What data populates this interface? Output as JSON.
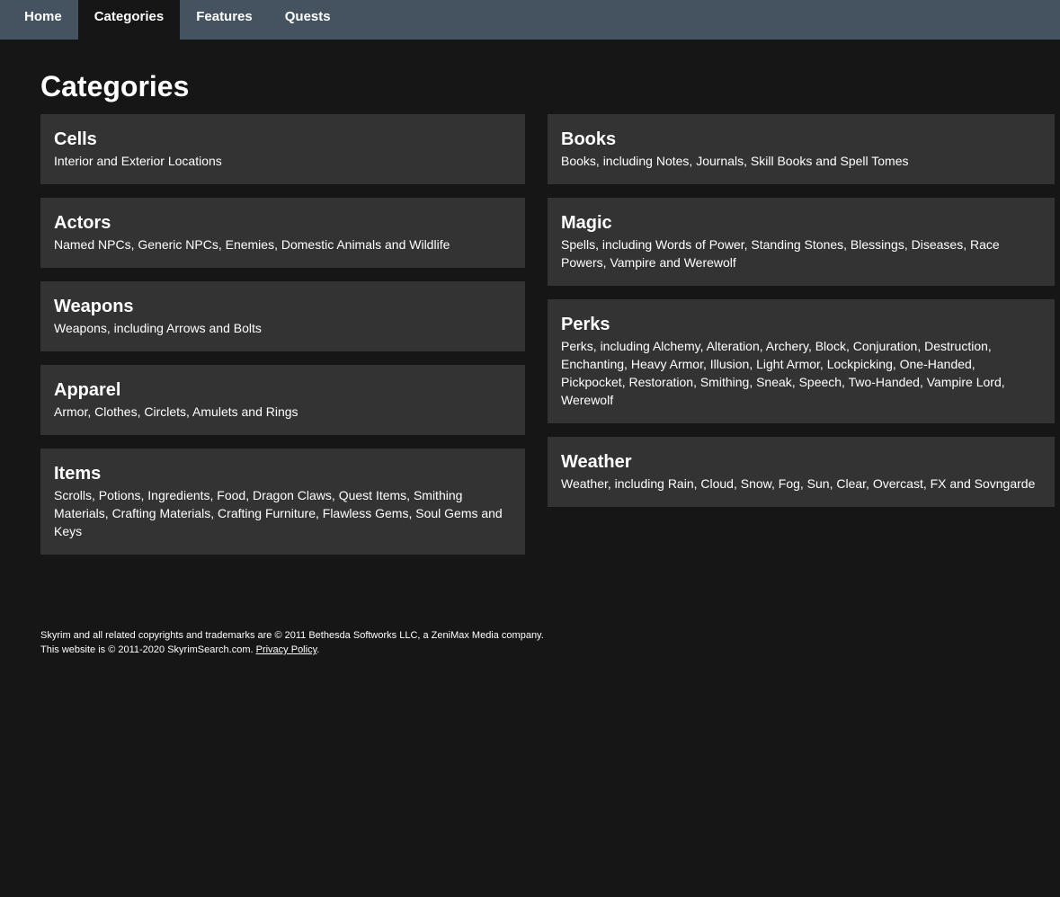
{
  "nav": {
    "items": [
      {
        "label": "Home"
      },
      {
        "label": "Categories"
      },
      {
        "label": "Features"
      },
      {
        "label": "Quests"
      }
    ],
    "active": "Categories"
  },
  "page": {
    "title": "Categories"
  },
  "categories_left": [
    {
      "title": "Cells",
      "desc": "Interior and Exterior Locations"
    },
    {
      "title": "Actors",
      "desc": "Named NPCs, Generic NPCs, Enemies, Domestic Animals and Wildlife"
    },
    {
      "title": "Weapons",
      "desc": "Weapons, including Arrows and Bolts"
    },
    {
      "title": "Apparel",
      "desc": "Armor, Clothes, Circlets, Amulets and Rings"
    },
    {
      "title": "Items",
      "desc": "Scrolls, Potions, Ingredients, Food, Dragon Claws, Quest Items, Smithing Materials, Crafting Materials, Crafting Furniture, Flawless Gems, Soul Gems and Keys"
    }
  ],
  "categories_right": [
    {
      "title": "Books",
      "desc": "Books, including Notes, Journals, Skill Books and Spell Tomes"
    },
    {
      "title": "Magic",
      "desc": "Spells, including Words of Power, Standing Stones, Blessings, Diseases, Race Powers, Vampire and Werewolf"
    },
    {
      "title": "Perks",
      "desc": "Perks, including Alchemy, Alteration, Archery, Block, Conjuration, Destruction, Enchanting, Heavy Armor, Illusion, Light Armor, Lockpicking, One-Handed, Pickpocket, Restoration, Smithing, Sneak, Speech, Two-Handed, Vampire Lord, Werewolf"
    },
    {
      "title": "Weather",
      "desc": "Weather, including Rain, Cloud, Snow, Fog, Sun, Clear, Overcast, FX and Sovngarde"
    }
  ],
  "footer": {
    "line1": "Skyrim and all related copyrights and trademarks are © 2011 Bethesda Softworks LLC, a ZeniMax Media company.",
    "line2_prefix": "This website is © 2011-2020 SkyrimSearch.com. ",
    "privacy_link": "Privacy Policy",
    "line2_suffix": "."
  },
  "colors": {
    "background": "#161616",
    "navbar": "#44535f",
    "card": "#333333",
    "text": "#ffffff"
  }
}
